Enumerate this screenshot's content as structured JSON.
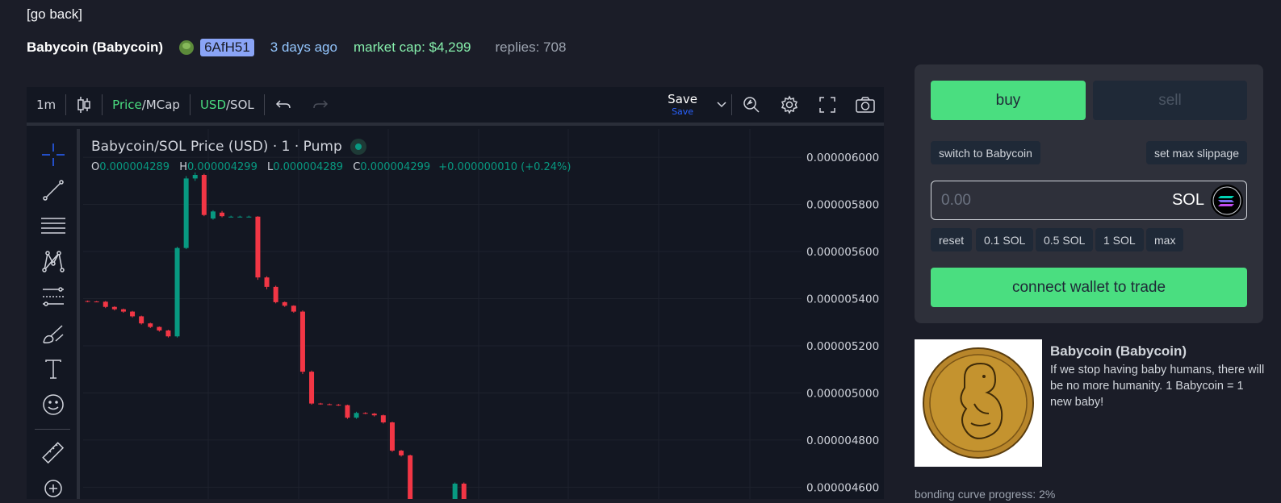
{
  "nav": {
    "back_label": "[go back]"
  },
  "header": {
    "token_name": "Babycoin (Babycoin)",
    "creator": "6AfH51",
    "age": "3 days ago",
    "market_cap": "market cap: $4,299",
    "replies": "replies: 708"
  },
  "chart_toolbar": {
    "interval": "1m",
    "price_label": "Price",
    "mcap_label": "/MCap",
    "usd_label": "USD",
    "sol_label": "/SOL",
    "save_label": "Save",
    "save_sub": "Save"
  },
  "chart_legend": {
    "title": "Babycoin/SOL Price (USD) · 1 · Pump",
    "o_label": "O",
    "o_value": "0.000004289",
    "h_label": "H",
    "h_value": "0.000004299",
    "l_label": "L",
    "l_value": "0.000004289",
    "c_label": "C",
    "c_value": "0.000004299",
    "change": "+0.000000010 (+0.24%)"
  },
  "chart_data": {
    "type": "candlestick",
    "y_ticks": [
      "0.000006000",
      "0.000005800",
      "0.000005600",
      "0.000005400",
      "0.000005200",
      "0.000005000",
      "0.000004800",
      "0.000004600"
    ],
    "ylim": [
      4.55e-06,
      6.12e-06
    ],
    "up_color": "#089981",
    "down_color": "#f23645",
    "candles": [
      [
        5.39e-06,
        5.392e-06,
        5.385e-06,
        5.388e-06
      ],
      [
        5.388e-06,
        5.39e-06,
        5.385e-06,
        5.387e-06
      ],
      [
        5.387e-06,
        5.39e-06,
        5.36e-06,
        5.365e-06
      ],
      [
        5.365e-06,
        5.368e-06,
        5.35e-06,
        5.355e-06
      ],
      [
        5.355e-06,
        5.358e-06,
        5.34e-06,
        5.345e-06
      ],
      [
        5.345e-06,
        5.348e-06,
        5.32e-06,
        5.325e-06
      ],
      [
        5.325e-06,
        5.328e-06,
        5.29e-06,
        5.295e-06
      ],
      [
        5.295e-06,
        5.298e-06,
        5.275e-06,
        5.28e-06
      ],
      [
        5.28e-06,
        5.282e-06,
        5.26e-06,
        5.265e-06
      ],
      [
        5.265e-06,
        5.268e-06,
        5.235e-06,
        5.24e-06
      ],
      [
        5.24e-06,
        5.62e-06,
        5.235e-06,
        5.615e-06
      ],
      [
        5.615e-06,
        5.92e-06,
        5.61e-06,
        5.91e-06
      ],
      [
        5.91e-06,
        5.935e-06,
        5.9e-06,
        5.925e-06
      ],
      [
        5.925e-06,
        5.93e-06,
        5.75e-06,
        5.755e-06
      ],
      [
        5.74e-06,
        5.775e-06,
        5.735e-06,
        5.77e-06
      ],
      [
        5.765e-06,
        5.772e-06,
        5.745e-06,
        5.75e-06
      ],
      [
        5.748e-06,
        5.752e-06,
        5.745e-06,
        5.748e-06
      ],
      [
        5.748e-06,
        5.752e-06,
        5.745e-06,
        5.748e-06
      ],
      [
        5.748e-06,
        5.752e-06,
        5.745e-06,
        5.748e-06
      ],
      [
        5.748e-06,
        5.75e-06,
        5.48e-06,
        5.49e-06
      ],
      [
        5.49e-06,
        5.495e-06,
        5.44e-06,
        5.45e-06
      ],
      [
        5.45e-06,
        5.455e-06,
        5.38e-06,
        5.385e-06
      ],
      [
        5.385e-06,
        5.388e-06,
        5.365e-06,
        5.37e-06
      ],
      [
        5.37e-06,
        5.372e-06,
        5.34e-06,
        5.345e-06
      ],
      [
        5.345e-06,
        5.35e-06,
        5.08e-06,
        5.09e-06
      ],
      [
        5.09e-06,
        5.095e-06,
        4.95e-06,
        4.955e-06
      ],
      [
        4.955e-06,
        4.958e-06,
        4.95e-06,
        4.952e-06
      ],
      [
        4.952e-06,
        4.955e-06,
        4.948e-06,
        4.95e-06
      ],
      [
        4.95e-06,
        4.953e-06,
        4.945e-06,
        4.948e-06
      ],
      [
        4.948e-06,
        4.95e-06,
        4.89e-06,
        4.895e-06
      ],
      [
        4.895e-06,
        4.92e-06,
        4.89e-06,
        4.915e-06
      ],
      [
        4.915e-06,
        4.918e-06,
        4.91e-06,
        4.912e-06
      ],
      [
        4.912e-06,
        4.915e-06,
        4.9e-06,
        4.905e-06
      ],
      [
        4.905e-06,
        4.908e-06,
        4.87e-06,
        4.875e-06
      ],
      [
        4.875e-06,
        4.878e-06,
        4.75e-06,
        4.755e-06
      ],
      [
        4.755e-06,
        4.758e-06,
        4.73e-06,
        4.735e-06
      ],
      [
        4.735e-06,
        4.738e-06,
        4.5e-06,
        4.51e-06
      ],
      [
        4.51e-06,
        4.52e-06,
        4.5e-06,
        4.505e-06
      ],
      [
        4.505e-06,
        4.51e-06,
        4.5e-06,
        4.502e-06
      ],
      [
        4.502e-06,
        4.505e-06,
        4.495e-06,
        4.5e-06
      ],
      [
        4.5e-06,
        4.505e-06,
        4.495e-06,
        4.498e-06
      ],
      [
        4.498e-06,
        4.62e-06,
        4.495e-06,
        4.615e-06
      ],
      [
        4.615e-06,
        4.62e-06,
        4.5e-06,
        4.505e-06
      ]
    ]
  },
  "trade_panel": {
    "buy_label": "buy",
    "sell_label": "sell",
    "switch_label": "switch to Babycoin",
    "slippage_label": "set max slippage",
    "amount_placeholder": "0.00",
    "unit": "SOL",
    "quick": [
      "reset",
      "0.1 SOL",
      "0.5 SOL",
      "1 SOL",
      "max"
    ],
    "connect_label": "connect wallet to trade"
  },
  "token_info": {
    "title": "Babycoin (Babycoin)",
    "description": "If we stop having baby humans, there will be no more humanity. 1 Babycoin = 1 new baby!",
    "below_left": "bonding curve progress: 2%"
  }
}
